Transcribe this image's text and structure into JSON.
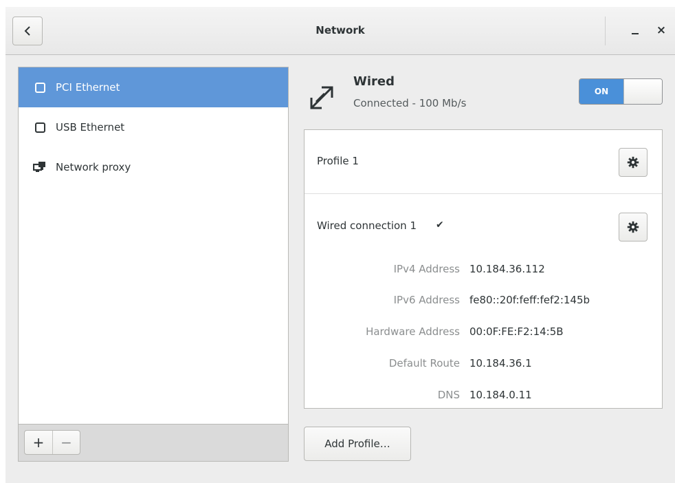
{
  "window": {
    "title": "Network"
  },
  "header": {
    "back_icon": "chevron-left-icon",
    "minimize_label": "minimize",
    "close_glyph": "×"
  },
  "sidebar": {
    "items": [
      {
        "label": "PCI Ethernet",
        "icon": "ethernet-icon",
        "selected": true
      },
      {
        "label": "USB Ethernet",
        "icon": "ethernet-icon",
        "selected": false
      },
      {
        "label": "Network proxy",
        "icon": "network-proxy-icon",
        "selected": false
      }
    ],
    "add_glyph": "+",
    "remove_glyph": "−"
  },
  "device": {
    "icon": "wired-connection-icon",
    "title": "Wired",
    "status": "Connected - 100 Mb/s",
    "toggle_label": "ON",
    "toggle_on": true
  },
  "profiles": [
    {
      "name": "Profile 1",
      "active": false
    },
    {
      "name": "Wired connection 1",
      "active": true,
      "check_glyph": "✔"
    }
  ],
  "details": [
    {
      "label": "IPv4 Address",
      "value": "10.184.36.112"
    },
    {
      "label": "IPv6 Address",
      "value": "fe80::20f:feff:fef2:145b"
    },
    {
      "label": "Hardware Address",
      "value": "00:0F:FE:F2:14:5B"
    },
    {
      "label": "Default Route",
      "value": "10.184.36.1"
    },
    {
      "label": "DNS",
      "value": "10.184.0.11"
    }
  ],
  "add_profile_label": "Add Profile…",
  "colors": {
    "selection": "#5f97d9",
    "toggle_on": "#4a90d9",
    "window_bg": "#ededed",
    "dim_text": "#8b8e8f"
  }
}
